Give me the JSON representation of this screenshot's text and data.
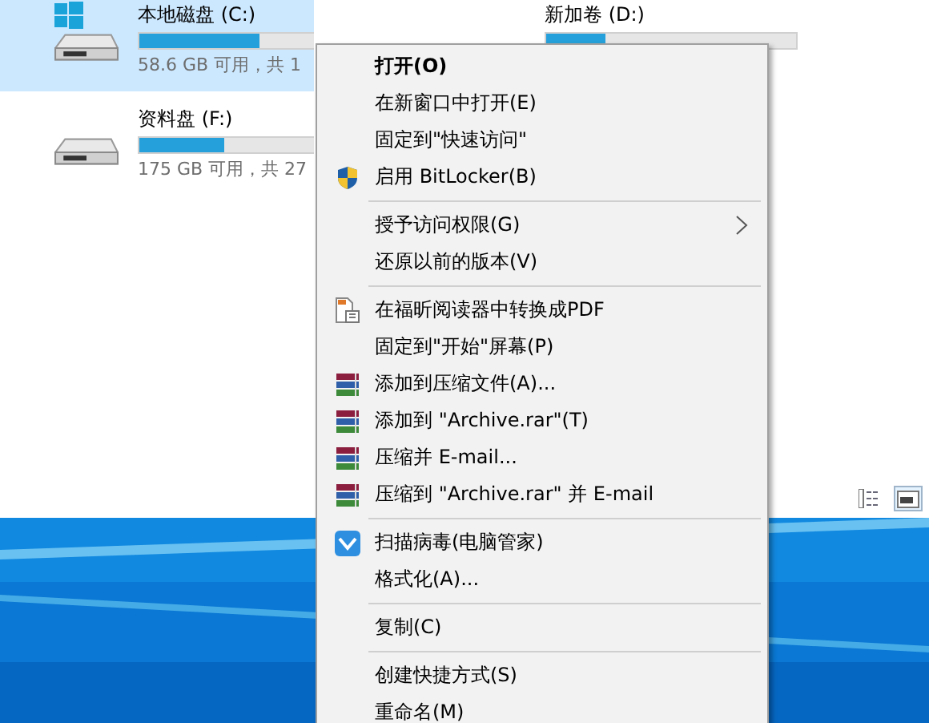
{
  "drives": [
    {
      "name": "本地磁盘 (C:)",
      "info": "58.6 GB 可用，共 1",
      "level": 0.48,
      "selected": true,
      "system": true
    },
    {
      "name": "新加卷 (D:)",
      "level": 0.24,
      "selected": false,
      "system": false
    },
    {
      "name": "资料盘 (F:)",
      "info": "175 GB 可用，共 27",
      "level": 0.34,
      "selected": false,
      "system": false
    }
  ],
  "view_buttons": [
    {
      "kind": "details",
      "selected": false
    },
    {
      "kind": "tiles",
      "selected": true
    }
  ],
  "context_menu": [
    {
      "kind": "item",
      "label": "打开(O)",
      "default": true
    },
    {
      "kind": "item",
      "label": "在新窗口中打开(E)"
    },
    {
      "kind": "item",
      "label": "固定到\"快速访问\""
    },
    {
      "kind": "bitlocker",
      "label": "启用 BitLocker(B)"
    },
    {
      "kind": "separator"
    },
    {
      "kind": "item",
      "label": "授予访问权限(G)",
      "submenu": true
    },
    {
      "kind": "item",
      "label": "还原以前的版本(V)"
    },
    {
      "kind": "separator"
    },
    {
      "kind": "pdf",
      "label": "在福昕阅读器中转换成PDF"
    },
    {
      "kind": "item",
      "label": "固定到\"开始\"屏幕(P)"
    },
    {
      "kind": "archive",
      "label": "添加到压缩文件(A)..."
    },
    {
      "kind": "archive",
      "label": "添加到 \"Archive.rar\"(T)"
    },
    {
      "kind": "archive",
      "label": "压缩并 E-mail..."
    },
    {
      "kind": "archive",
      "label": "压缩到 \"Archive.rar\" 并 E-mail"
    },
    {
      "kind": "separator"
    },
    {
      "kind": "antivirus",
      "label": "扫描病毒(电脑管家)"
    },
    {
      "kind": "item",
      "label": "格式化(A)..."
    },
    {
      "kind": "separator"
    },
    {
      "kind": "item",
      "label": "复制(C)"
    },
    {
      "kind": "separator"
    },
    {
      "kind": "item",
      "label": "创建快捷方式(S)"
    },
    {
      "kind": "item",
      "label": "重命名(M)"
    }
  ]
}
